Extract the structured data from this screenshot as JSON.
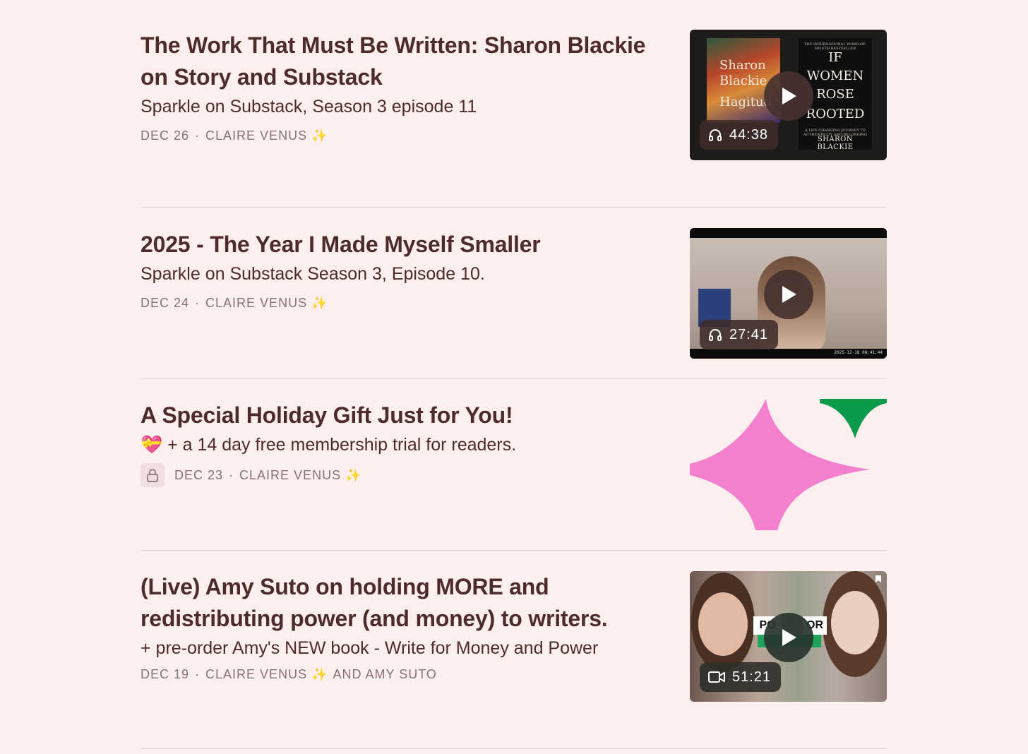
{
  "posts": [
    {
      "title": "The Work That Must Be Written: Sharon Blackie on Story and Substack",
      "subtitle": "Sparkle on Substack, Season 3 episode 11",
      "date": "DEC 26",
      "authors": "CLAIRE VENUS",
      "sparkle": "✨",
      "duration": "44:38",
      "media_icon": "headphones-icon",
      "thumb_text": {
        "left_book": [
          "Sharon",
          "Blackie",
          "Hagitud"
        ],
        "right_book_small_top": "THE INTERNATIONAL WORD-OF-MOUTH BESTSELLER",
        "right_book_title": [
          "IF",
          "WOMEN",
          "ROSE",
          "ROOTED"
        ],
        "right_book_small_bottom": "A LIFE CHANGING JOURNEY TO AUTHENTICITY AND BELONGING",
        "right_book_author": "SHARON BLACKIE"
      }
    },
    {
      "title": "2025 - The Year I Made Myself Smaller",
      "subtitle": "Sparkle on Substack Season 3, Episode 10.",
      "date": "DEC 24",
      "authors": "CLAIRE VENUS",
      "sparkle": "✨",
      "duration": "27:41",
      "media_icon": "headphones-icon",
      "thumb_text": {
        "timestamp": "2025-12-18 08:41:44"
      }
    },
    {
      "title": "A Special Holiday Gift Just for You!",
      "subtitle_emoji": "💝",
      "subtitle": "+ a 14 day free membership trial for readers.",
      "date": "DEC 23",
      "authors": "CLAIRE VENUS",
      "sparkle": "✨",
      "locked": true
    },
    {
      "title": "(Live) Amy Suto on holding MORE and redistributing power (and money) to writers.",
      "subtitle": "+ pre-order Amy's NEW book - Write for Money and Power",
      "date": "DEC 19",
      "authors": "CLAIRE VENUS",
      "sparkle": "✨",
      "authors_suffix": "AND AMY SUTO",
      "duration": "51:21",
      "media_icon": "video-camera-icon",
      "thumb_text": {
        "sign_left": "PO",
        "sign_right": "OR"
      }
    }
  ],
  "colors": {
    "background": "#fcefee",
    "title": "#4e2b2b",
    "meta": "#857373",
    "divider": "#e2d3d2",
    "sparkle_pink": "#f47fcf",
    "sparkle_green": "#0c9a4c"
  }
}
